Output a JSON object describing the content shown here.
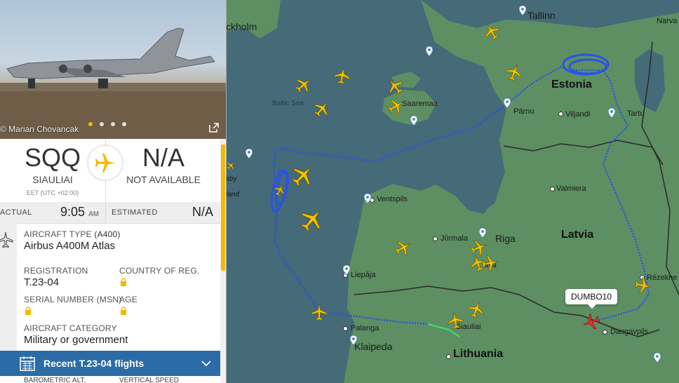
{
  "map": {
    "labels": {
      "stockholm": "ckholm",
      "tallinn": "Tallinn",
      "narva": "Narva",
      "baltic_sea": "Baltic Sea",
      "saaremaa": "Saaremaa",
      "parnu": "Pärnu",
      "viljandi": "Viljandi",
      "tartu": "Tartu",
      "estonia": "Estonia",
      "valmiera": "Valmiera",
      "ventspils": "Ventspils",
      "jurmala": "Jūrmala",
      "riga": "Riga",
      "latvia": "Latvia",
      "liepaja": "Liepāja",
      "rezekne": "Rēzekne",
      "palanga": "Palanga",
      "siauliai": "Šiauliai",
      "klaipeda": "Klaipeda",
      "lithuania": "Lithuania",
      "daugavpils": "Daugavpils",
      "sby": "sby",
      "land": "land",
      "jelgava": "ava"
    },
    "callout": "DUMBO10",
    "colors": {
      "track": "#2a52e6",
      "plane": "#f5c300",
      "selected_plane": "#e8332c",
      "land": "#5d8f63",
      "sea": "#456a78"
    }
  },
  "panel": {
    "photo_credit": "© Marian Chovancak",
    "photo_count": 4,
    "photo_active": 1,
    "origin": {
      "code": "SQQ",
      "name": "SIAULIAI",
      "timezone": "EET (UTC +02:00)"
    },
    "destination": {
      "code": "N/A",
      "name": "NOT AVAILABLE"
    },
    "actual_label": "ACTUAL",
    "actual_time": "9:05",
    "actual_ampm": "AM",
    "estimated_label": "ESTIMATED",
    "estimated_time": "N/A",
    "aircraft_type_label": "AIRCRAFT TYPE",
    "aircraft_type_code": "(A400)",
    "aircraft_type": "Airbus A400M Atlas",
    "registration_label": "REGISTRATION",
    "registration": "T.23-04",
    "country_label": "COUNTRY OF REG.",
    "msn_label": "SERIAL NUMBER (MSN)",
    "age_label": "AGE",
    "category_label": "AIRCRAFT CATEGORY",
    "category": "Military or government",
    "recent_label": "Recent T.23-04 flights",
    "bottom_left": "BAROMETRIC ALT.",
    "bottom_right": "VERTICAL SPEED"
  }
}
